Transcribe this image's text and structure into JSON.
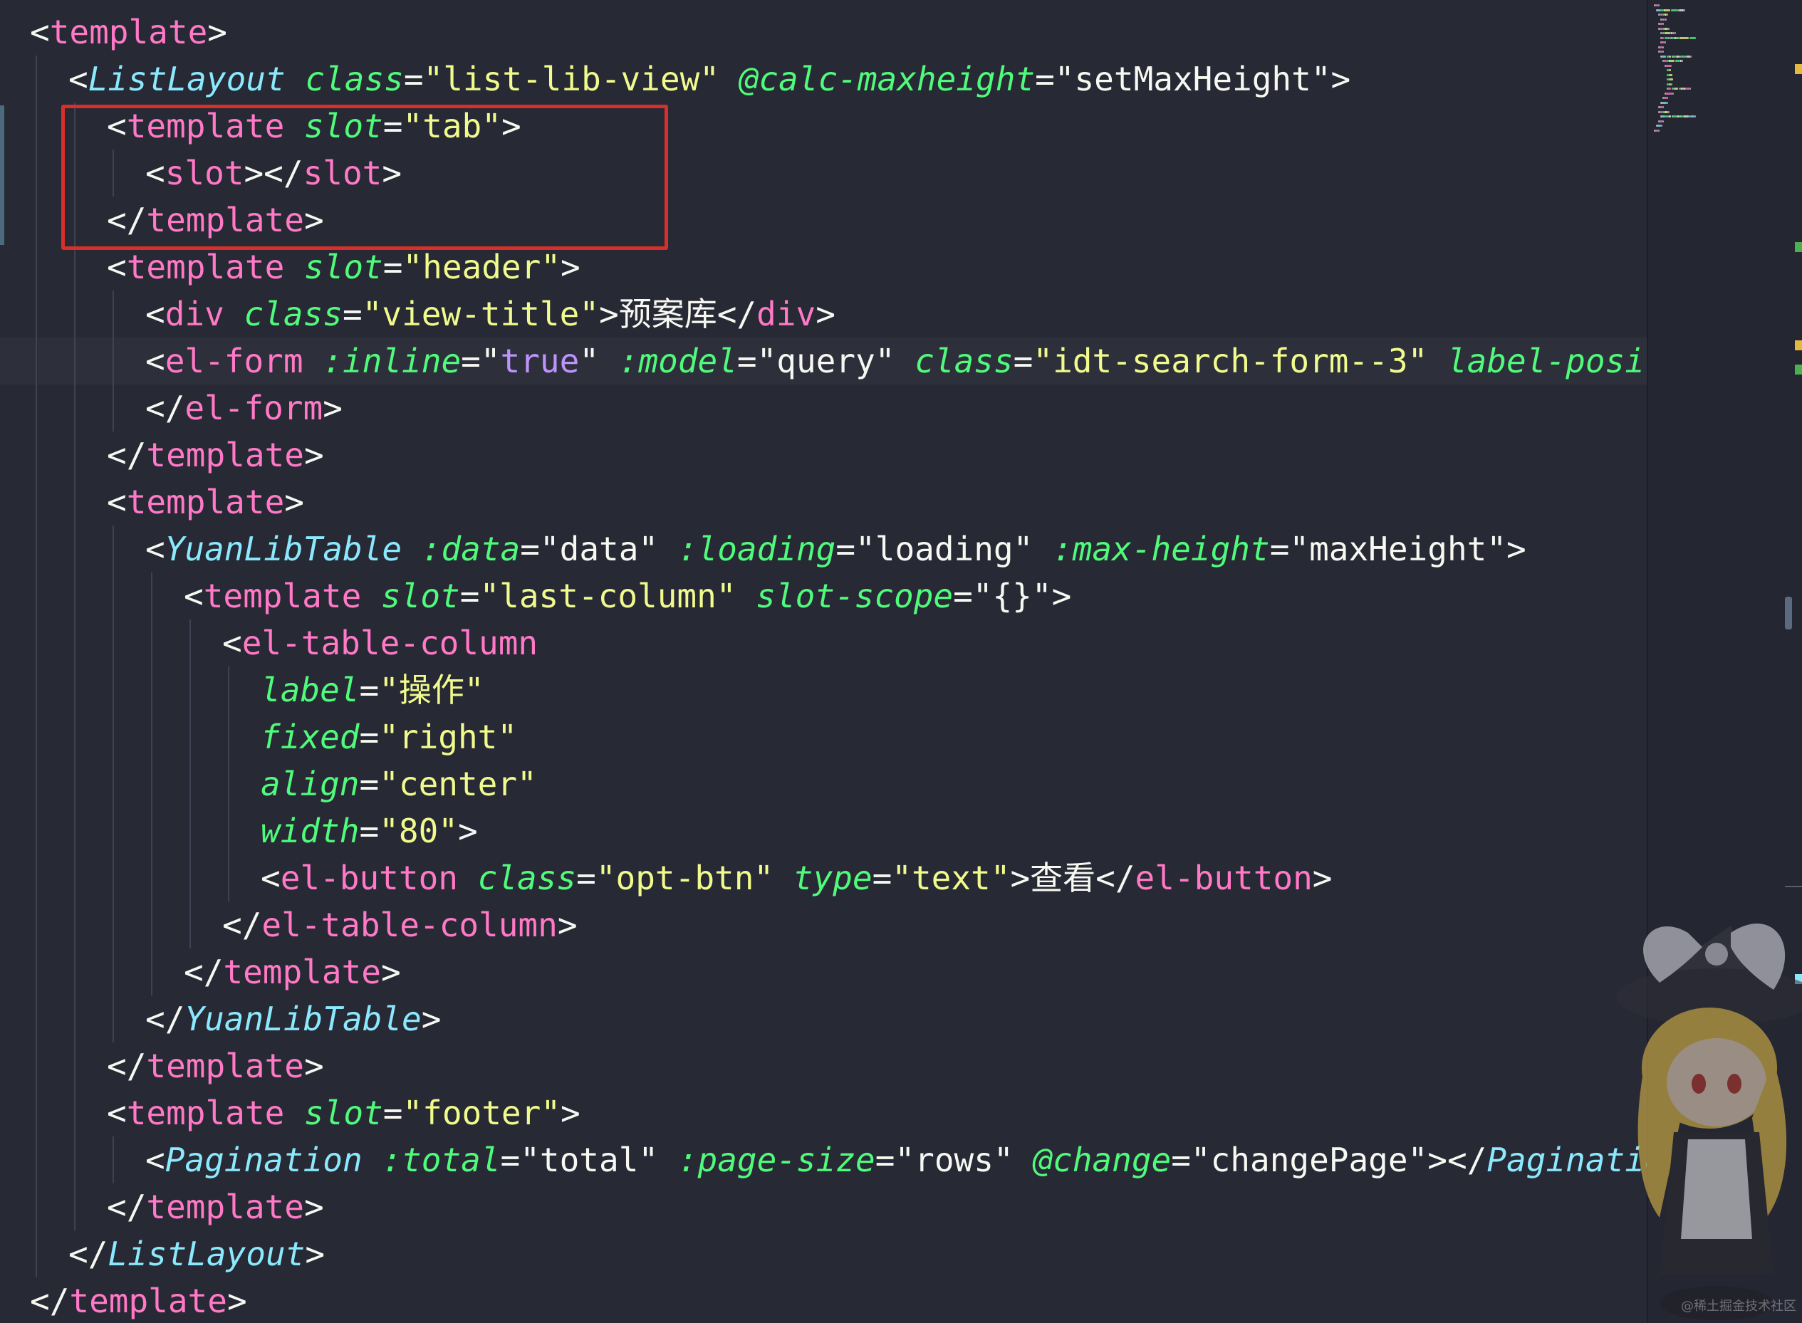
{
  "editor": {
    "lines": [
      {
        "indent": 0,
        "tokens": [
          [
            "punct",
            "<"
          ],
          [
            "tag",
            "template"
          ],
          [
            "punct",
            ">"
          ]
        ]
      },
      {
        "indent": 1,
        "tokens": [
          [
            "punct",
            "<"
          ],
          [
            "comp",
            "ListLayout"
          ],
          [
            "text",
            " "
          ],
          [
            "attr",
            "class"
          ],
          [
            "punct",
            "="
          ],
          [
            "str",
            "\"list-lib-view\""
          ],
          [
            "text",
            " "
          ],
          [
            "dir",
            "@calc-maxheight"
          ],
          [
            "punct",
            "=\""
          ],
          [
            "expr",
            "setMaxHeight"
          ],
          [
            "punct",
            "\">"
          ]
        ]
      },
      {
        "indent": 2,
        "tokens": [
          [
            "punct",
            "<"
          ],
          [
            "tag",
            "template"
          ],
          [
            "text",
            " "
          ],
          [
            "attr",
            "slot"
          ],
          [
            "punct",
            "="
          ],
          [
            "str",
            "\"tab\""
          ],
          [
            "punct",
            ">"
          ]
        ]
      },
      {
        "indent": 3,
        "tokens": [
          [
            "punct",
            "<"
          ],
          [
            "tag",
            "slot"
          ],
          [
            "punct",
            "></"
          ],
          [
            "tag",
            "slot"
          ],
          [
            "punct",
            ">"
          ]
        ]
      },
      {
        "indent": 2,
        "tokens": [
          [
            "punct",
            "</"
          ],
          [
            "tag",
            "template"
          ],
          [
            "punct",
            ">"
          ]
        ]
      },
      {
        "indent": 2,
        "tokens": [
          [
            "punct",
            "<"
          ],
          [
            "tag",
            "template"
          ],
          [
            "text",
            " "
          ],
          [
            "attr",
            "slot"
          ],
          [
            "punct",
            "="
          ],
          [
            "str",
            "\"header\""
          ],
          [
            "punct",
            ">"
          ]
        ]
      },
      {
        "indent": 3,
        "tokens": [
          [
            "punct",
            "<"
          ],
          [
            "tag",
            "div"
          ],
          [
            "text",
            " "
          ],
          [
            "attr",
            "class"
          ],
          [
            "punct",
            "="
          ],
          [
            "str",
            "\"view-title\""
          ],
          [
            "punct",
            ">"
          ],
          [
            "text",
            "预案库"
          ],
          [
            "punct",
            "</"
          ],
          [
            "tag",
            "div"
          ],
          [
            "punct",
            ">"
          ]
        ]
      },
      {
        "indent": 3,
        "current": true,
        "tokens": [
          [
            "punct",
            "<"
          ],
          [
            "tag",
            "el-form"
          ],
          [
            "text",
            " "
          ],
          [
            "dir",
            ":inline"
          ],
          [
            "punct",
            "=\""
          ],
          [
            "kw",
            "true"
          ],
          [
            "punct",
            "\""
          ],
          [
            "text",
            " "
          ],
          [
            "dir",
            ":model"
          ],
          [
            "punct",
            "=\""
          ],
          [
            "expr",
            "query"
          ],
          [
            "punct",
            "\""
          ],
          [
            "text",
            " "
          ],
          [
            "attr",
            "class"
          ],
          [
            "punct",
            "="
          ],
          [
            "str",
            "\"idt-search-form--3\""
          ],
          [
            "text",
            " "
          ],
          [
            "attr",
            "label-position"
          ]
        ]
      },
      {
        "indent": 3,
        "tokens": [
          [
            "punct",
            "</"
          ],
          [
            "tag",
            "el-form"
          ],
          [
            "punct",
            ">"
          ]
        ]
      },
      {
        "indent": 2,
        "tokens": [
          [
            "punct",
            "</"
          ],
          [
            "tag",
            "template"
          ],
          [
            "punct",
            ">"
          ]
        ]
      },
      {
        "indent": 2,
        "tokens": [
          [
            "punct",
            "<"
          ],
          [
            "tag",
            "template"
          ],
          [
            "punct",
            ">"
          ]
        ]
      },
      {
        "indent": 3,
        "tokens": [
          [
            "punct",
            "<"
          ],
          [
            "comp",
            "YuanLibTable"
          ],
          [
            "text",
            " "
          ],
          [
            "dir",
            ":data"
          ],
          [
            "punct",
            "=\""
          ],
          [
            "expr",
            "data"
          ],
          [
            "punct",
            "\""
          ],
          [
            "text",
            " "
          ],
          [
            "dir",
            ":loading"
          ],
          [
            "punct",
            "=\""
          ],
          [
            "expr",
            "loading"
          ],
          [
            "punct",
            "\""
          ],
          [
            "text",
            " "
          ],
          [
            "dir",
            ":max-height"
          ],
          [
            "punct",
            "=\""
          ],
          [
            "expr",
            "maxHeight"
          ],
          [
            "punct",
            "\">"
          ]
        ]
      },
      {
        "indent": 4,
        "tokens": [
          [
            "punct",
            "<"
          ],
          [
            "tag",
            "template"
          ],
          [
            "text",
            " "
          ],
          [
            "attr",
            "slot"
          ],
          [
            "punct",
            "="
          ],
          [
            "str",
            "\"last-column\""
          ],
          [
            "text",
            " "
          ],
          [
            "attr",
            "slot-scope"
          ],
          [
            "punct",
            "=\""
          ],
          [
            "expr",
            "{}"
          ],
          [
            "punct",
            "\">"
          ]
        ]
      },
      {
        "indent": 5,
        "tokens": [
          [
            "punct",
            "<"
          ],
          [
            "tag",
            "el-table-column"
          ]
        ]
      },
      {
        "indent": 6,
        "tokens": [
          [
            "attr",
            "label"
          ],
          [
            "punct",
            "="
          ],
          [
            "str",
            "\"操作\""
          ]
        ]
      },
      {
        "indent": 6,
        "tokens": [
          [
            "attr",
            "fixed"
          ],
          [
            "punct",
            "="
          ],
          [
            "str",
            "\"right\""
          ]
        ]
      },
      {
        "indent": 6,
        "tokens": [
          [
            "attr",
            "align"
          ],
          [
            "punct",
            "="
          ],
          [
            "str",
            "\"center\""
          ]
        ]
      },
      {
        "indent": 6,
        "tokens": [
          [
            "attr",
            "width"
          ],
          [
            "punct",
            "="
          ],
          [
            "str",
            "\"80\""
          ],
          [
            "punct",
            ">"
          ]
        ]
      },
      {
        "indent": 6,
        "tokens": [
          [
            "punct",
            "<"
          ],
          [
            "tag",
            "el-button"
          ],
          [
            "text",
            " "
          ],
          [
            "attr",
            "class"
          ],
          [
            "punct",
            "="
          ],
          [
            "str",
            "\"opt-btn\""
          ],
          [
            "text",
            " "
          ],
          [
            "attr",
            "type"
          ],
          [
            "punct",
            "="
          ],
          [
            "str",
            "\"text\""
          ],
          [
            "punct",
            ">"
          ],
          [
            "text",
            "查看"
          ],
          [
            "punct",
            "</"
          ],
          [
            "tag",
            "el-button"
          ],
          [
            "punct",
            ">"
          ]
        ]
      },
      {
        "indent": 5,
        "tokens": [
          [
            "punct",
            "</"
          ],
          [
            "tag",
            "el-table-column"
          ],
          [
            "punct",
            ">"
          ]
        ]
      },
      {
        "indent": 4,
        "tokens": [
          [
            "punct",
            "</"
          ],
          [
            "tag",
            "template"
          ],
          [
            "punct",
            ">"
          ]
        ]
      },
      {
        "indent": 3,
        "tokens": [
          [
            "punct",
            "</"
          ],
          [
            "comp",
            "YuanLibTable"
          ],
          [
            "punct",
            ">"
          ]
        ]
      },
      {
        "indent": 2,
        "tokens": [
          [
            "punct",
            "</"
          ],
          [
            "tag",
            "template"
          ],
          [
            "punct",
            ">"
          ]
        ]
      },
      {
        "indent": 2,
        "tokens": [
          [
            "punct",
            "<"
          ],
          [
            "tag",
            "template"
          ],
          [
            "text",
            " "
          ],
          [
            "attr",
            "slot"
          ],
          [
            "punct",
            "="
          ],
          [
            "str",
            "\"footer\""
          ],
          [
            "punct",
            ">"
          ]
        ]
      },
      {
        "indent": 3,
        "tokens": [
          [
            "punct",
            "<"
          ],
          [
            "comp",
            "Pagination"
          ],
          [
            "text",
            " "
          ],
          [
            "dir",
            ":total"
          ],
          [
            "punct",
            "=\""
          ],
          [
            "expr",
            "total"
          ],
          [
            "punct",
            "\""
          ],
          [
            "text",
            " "
          ],
          [
            "dir",
            ":page-size"
          ],
          [
            "punct",
            "=\""
          ],
          [
            "expr",
            "rows"
          ],
          [
            "punct",
            "\""
          ],
          [
            "text",
            " "
          ],
          [
            "dir",
            "@change"
          ],
          [
            "punct",
            "=\""
          ],
          [
            "expr",
            "changePage"
          ],
          [
            "punct",
            "\"></"
          ],
          [
            "comp",
            "Pagination"
          ],
          [
            "punct",
            ">"
          ]
        ]
      },
      {
        "indent": 2,
        "tokens": [
          [
            "punct",
            "</"
          ],
          [
            "tag",
            "template"
          ],
          [
            "punct",
            ">"
          ]
        ]
      },
      {
        "indent": 1,
        "tokens": [
          [
            "punct",
            "</"
          ],
          [
            "comp",
            "ListLayout"
          ],
          [
            "punct",
            ">"
          ]
        ]
      },
      {
        "indent": 0,
        "tokens": [
          [
            "punct",
            "</"
          ],
          [
            "tag",
            "template"
          ],
          [
            "punct",
            ">"
          ]
        ]
      }
    ]
  },
  "colors": {
    "background": "#272935",
    "highlight_box": "#d7302a"
  },
  "watermark": "@稀土掘金技术社区"
}
